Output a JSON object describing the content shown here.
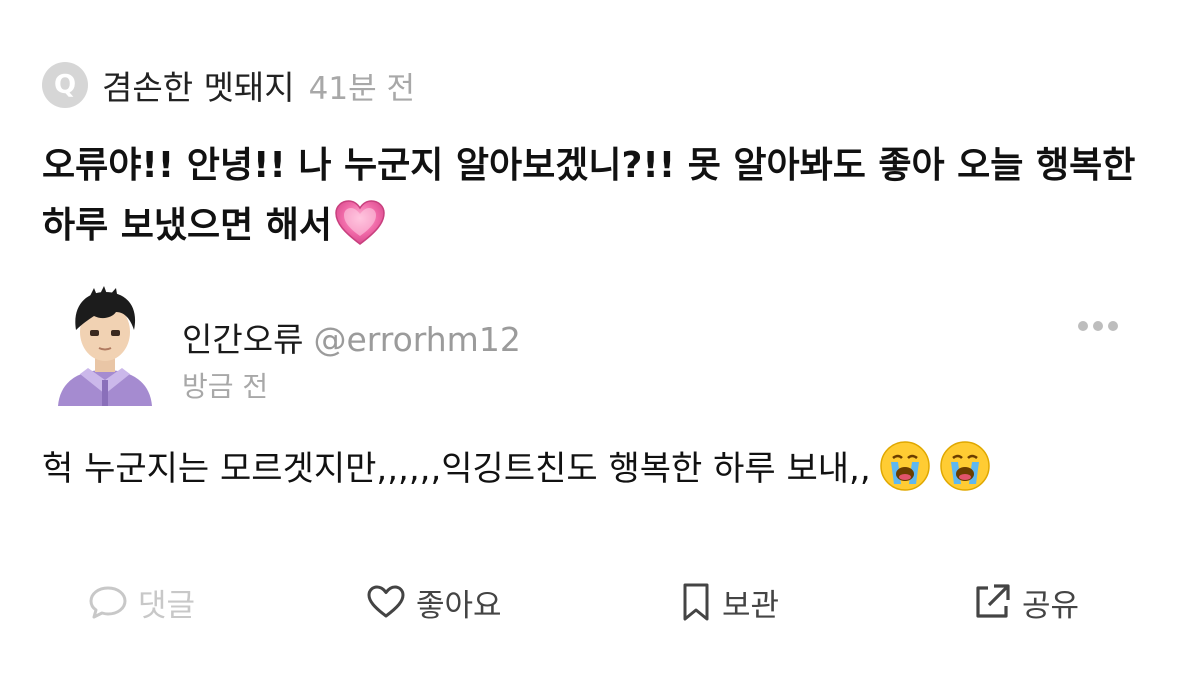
{
  "question": {
    "badge_letter": "Q",
    "asker_name": "겸손한 멧돼지",
    "time": "41분 전",
    "text": "오류야!! 안녕!! 나 누군지 알아보겠니?!! 못 알아봐도 좋아 오늘 행복한 하루 보냈으면 해서",
    "emoji": "heart-emoji"
  },
  "answer": {
    "name": "인간오류",
    "handle": "@errorhm12",
    "time": "방금 전",
    "text": "헉 누군지는 모르겟지만,,,,,,익깅트친도 행복한 하루 보내,,",
    "emojis": [
      "crying-face-emoji",
      "crying-face-emoji"
    ]
  },
  "actions": {
    "comment_label": "댓글",
    "like_label": "좋아요",
    "save_label": "보관",
    "share_label": "공유"
  },
  "colors": {
    "primary_text": "#111111",
    "secondary_text": "#a8a8a8",
    "disabled": "#c8c8c8",
    "heart": "#f06aa8",
    "avatar_jacket": "#a58bd0"
  }
}
